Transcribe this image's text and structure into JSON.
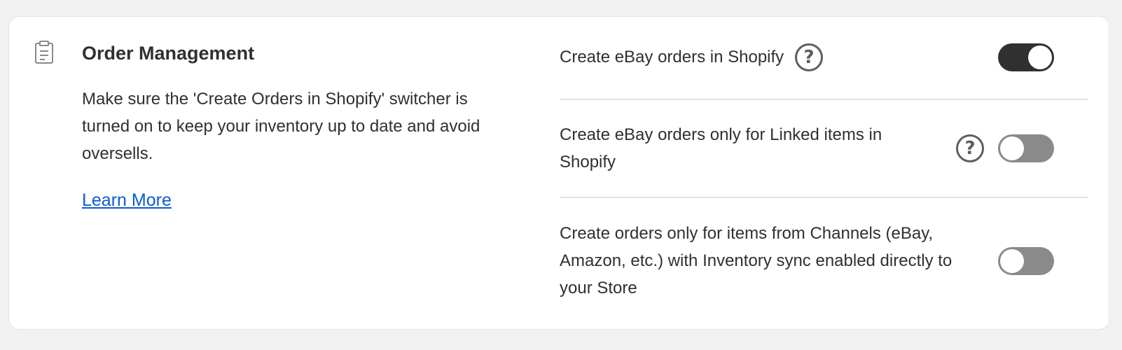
{
  "section": {
    "icon": "clipboard-icon",
    "title": "Order Management",
    "description": "Make sure the 'Create Orders in Shopify' switcher is turned on to keep your inventory up to date and avoid oversells.",
    "learn_more": "Learn More"
  },
  "settings": [
    {
      "label": "Create eBay orders in Shopify",
      "has_help": true,
      "enabled": true
    },
    {
      "label": "Create eBay orders only for Linked items in Shopify",
      "has_help": true,
      "enabled": false
    },
    {
      "label": "Create orders only for items from Channels (eBay, Amazon, etc.) with Inventory sync enabled directly to your Store",
      "has_help": false,
      "enabled": false
    }
  ],
  "help_glyph": "?",
  "colors": {
    "toggle_on": "#303030",
    "toggle_off": "#8a8a8a",
    "link": "#0b5bd3"
  }
}
